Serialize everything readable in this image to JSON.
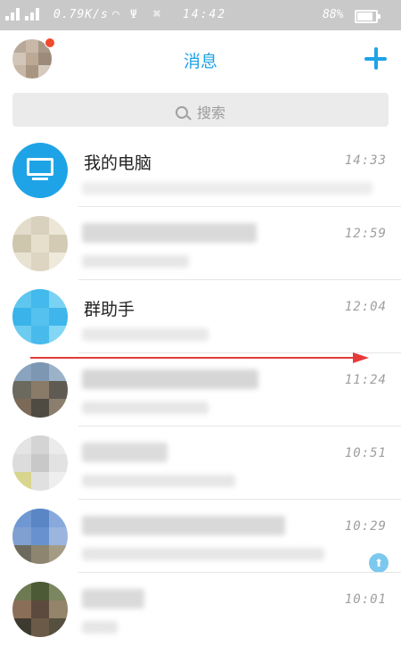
{
  "status_bar": {
    "network_speed": "0.79K/s",
    "time": "14:42",
    "battery": "88%"
  },
  "header": {
    "title": "消息",
    "add_icon": "plus-icon",
    "colors": {
      "accent": "#1ea4e6",
      "badge": "#f24a2e"
    }
  },
  "search": {
    "placeholder": "搜索",
    "icon": "search-icon"
  },
  "conversations": [
    {
      "name": "我的电脑",
      "time": "14:33",
      "avatar": "computer-icon"
    },
    {
      "name": "",
      "time": "12:59"
    },
    {
      "name": "群助手",
      "time": "12:04"
    },
    {
      "name": "",
      "time": "11:24"
    },
    {
      "name": "",
      "time": "10:51"
    },
    {
      "name": "",
      "time": "10:29",
      "pinned_icon": "pin-icon"
    },
    {
      "name": "",
      "time": "10:01"
    }
  ]
}
